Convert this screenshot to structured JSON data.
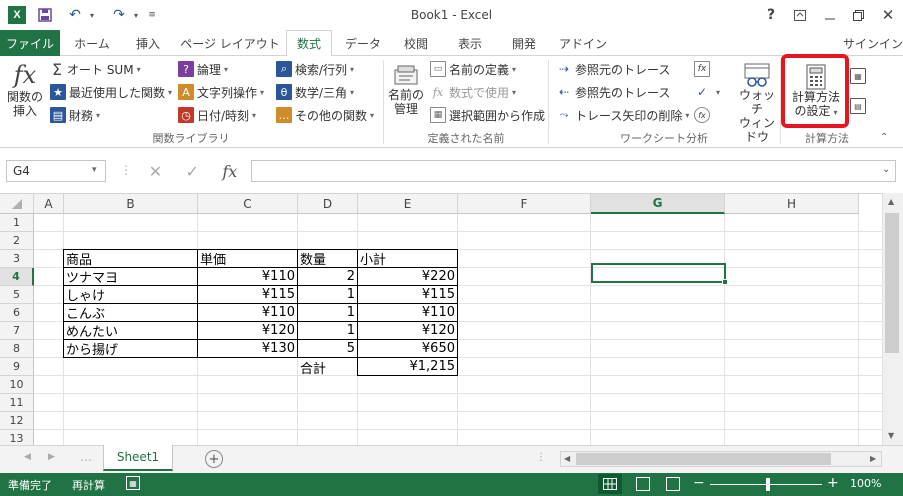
{
  "window": {
    "title": "Book1 - Excel"
  },
  "qat": {
    "save": "save-icon",
    "undo": "↶",
    "redo": "↷"
  },
  "tabs": [
    {
      "label": "ファイル"
    },
    {
      "label": "ホーム"
    },
    {
      "label": "挿入"
    },
    {
      "label": "ページ レイアウト"
    },
    {
      "label": "数式"
    },
    {
      "label": "データ"
    },
    {
      "label": "校閲"
    },
    {
      "label": "表示"
    },
    {
      "label": "開発"
    },
    {
      "label": "アドイン"
    }
  ],
  "active_tab": "数式",
  "signin": "サインイン",
  "ribbon": {
    "func_lib": {
      "insert_fn_1": "関数の",
      "insert_fn_2": "挿入",
      "autosum": "オート SUM",
      "recent": "最近使用した関数",
      "finance": "財務",
      "logical": "論理",
      "text": "文字列操作",
      "datetime": "日付/時刻",
      "lookup": "検索/行列",
      "math": "数学/三角",
      "other": "その他の関数",
      "label": "関数ライブラリ"
    },
    "names": {
      "manager_1": "名前の",
      "manager_2": "管理",
      "define": "名前の定義",
      "use_in_formula": "数式で使用",
      "create_from_sel": "選択範囲から作成",
      "label": "定義された名前"
    },
    "audit": {
      "trace_prec": "参照元のトレース",
      "trace_dep": "参照先のトレース",
      "remove_arrows": "トレース矢印の削除",
      "watch_1": "ウォッチ",
      "watch_2": "ウィンドウ",
      "label": "ワークシート分析"
    },
    "calc": {
      "options_1": "計算方法",
      "options_2": "の設定",
      "label": "計算方法"
    }
  },
  "formula_bar": {
    "name_box": "G4",
    "fx": "fx",
    "content": ""
  },
  "sheet": {
    "columns": [
      "A",
      "B",
      "C",
      "D",
      "E",
      "F",
      "G",
      "H"
    ],
    "selected_column": "G",
    "rows": [
      "1",
      "2",
      "3",
      "4",
      "5",
      "6",
      "7",
      "8",
      "9",
      "10",
      "11",
      "12",
      "13"
    ],
    "selected_row": "4",
    "table_headers": [
      "商品",
      "単価",
      "数量",
      "小計"
    ],
    "table_rows": [
      [
        "ツナマヨ",
        "¥110",
        "2",
        "¥220"
      ],
      [
        "しゃけ",
        "¥115",
        "1",
        "¥115"
      ],
      [
        "こんぶ",
        "¥110",
        "1",
        "¥110"
      ],
      [
        "めんたい",
        "¥120",
        "1",
        "¥120"
      ],
      [
        "から揚げ",
        "¥130",
        "5",
        "¥650"
      ]
    ],
    "total_label": "合計",
    "total_value": "¥1,215",
    "tab_name": "Sheet1"
  },
  "status": {
    "ready": "準備完了",
    "recalc": "再計算",
    "zoom": "100%"
  },
  "colors": {
    "excel_green": "#217346",
    "highlight_red": "#e8141e"
  }
}
